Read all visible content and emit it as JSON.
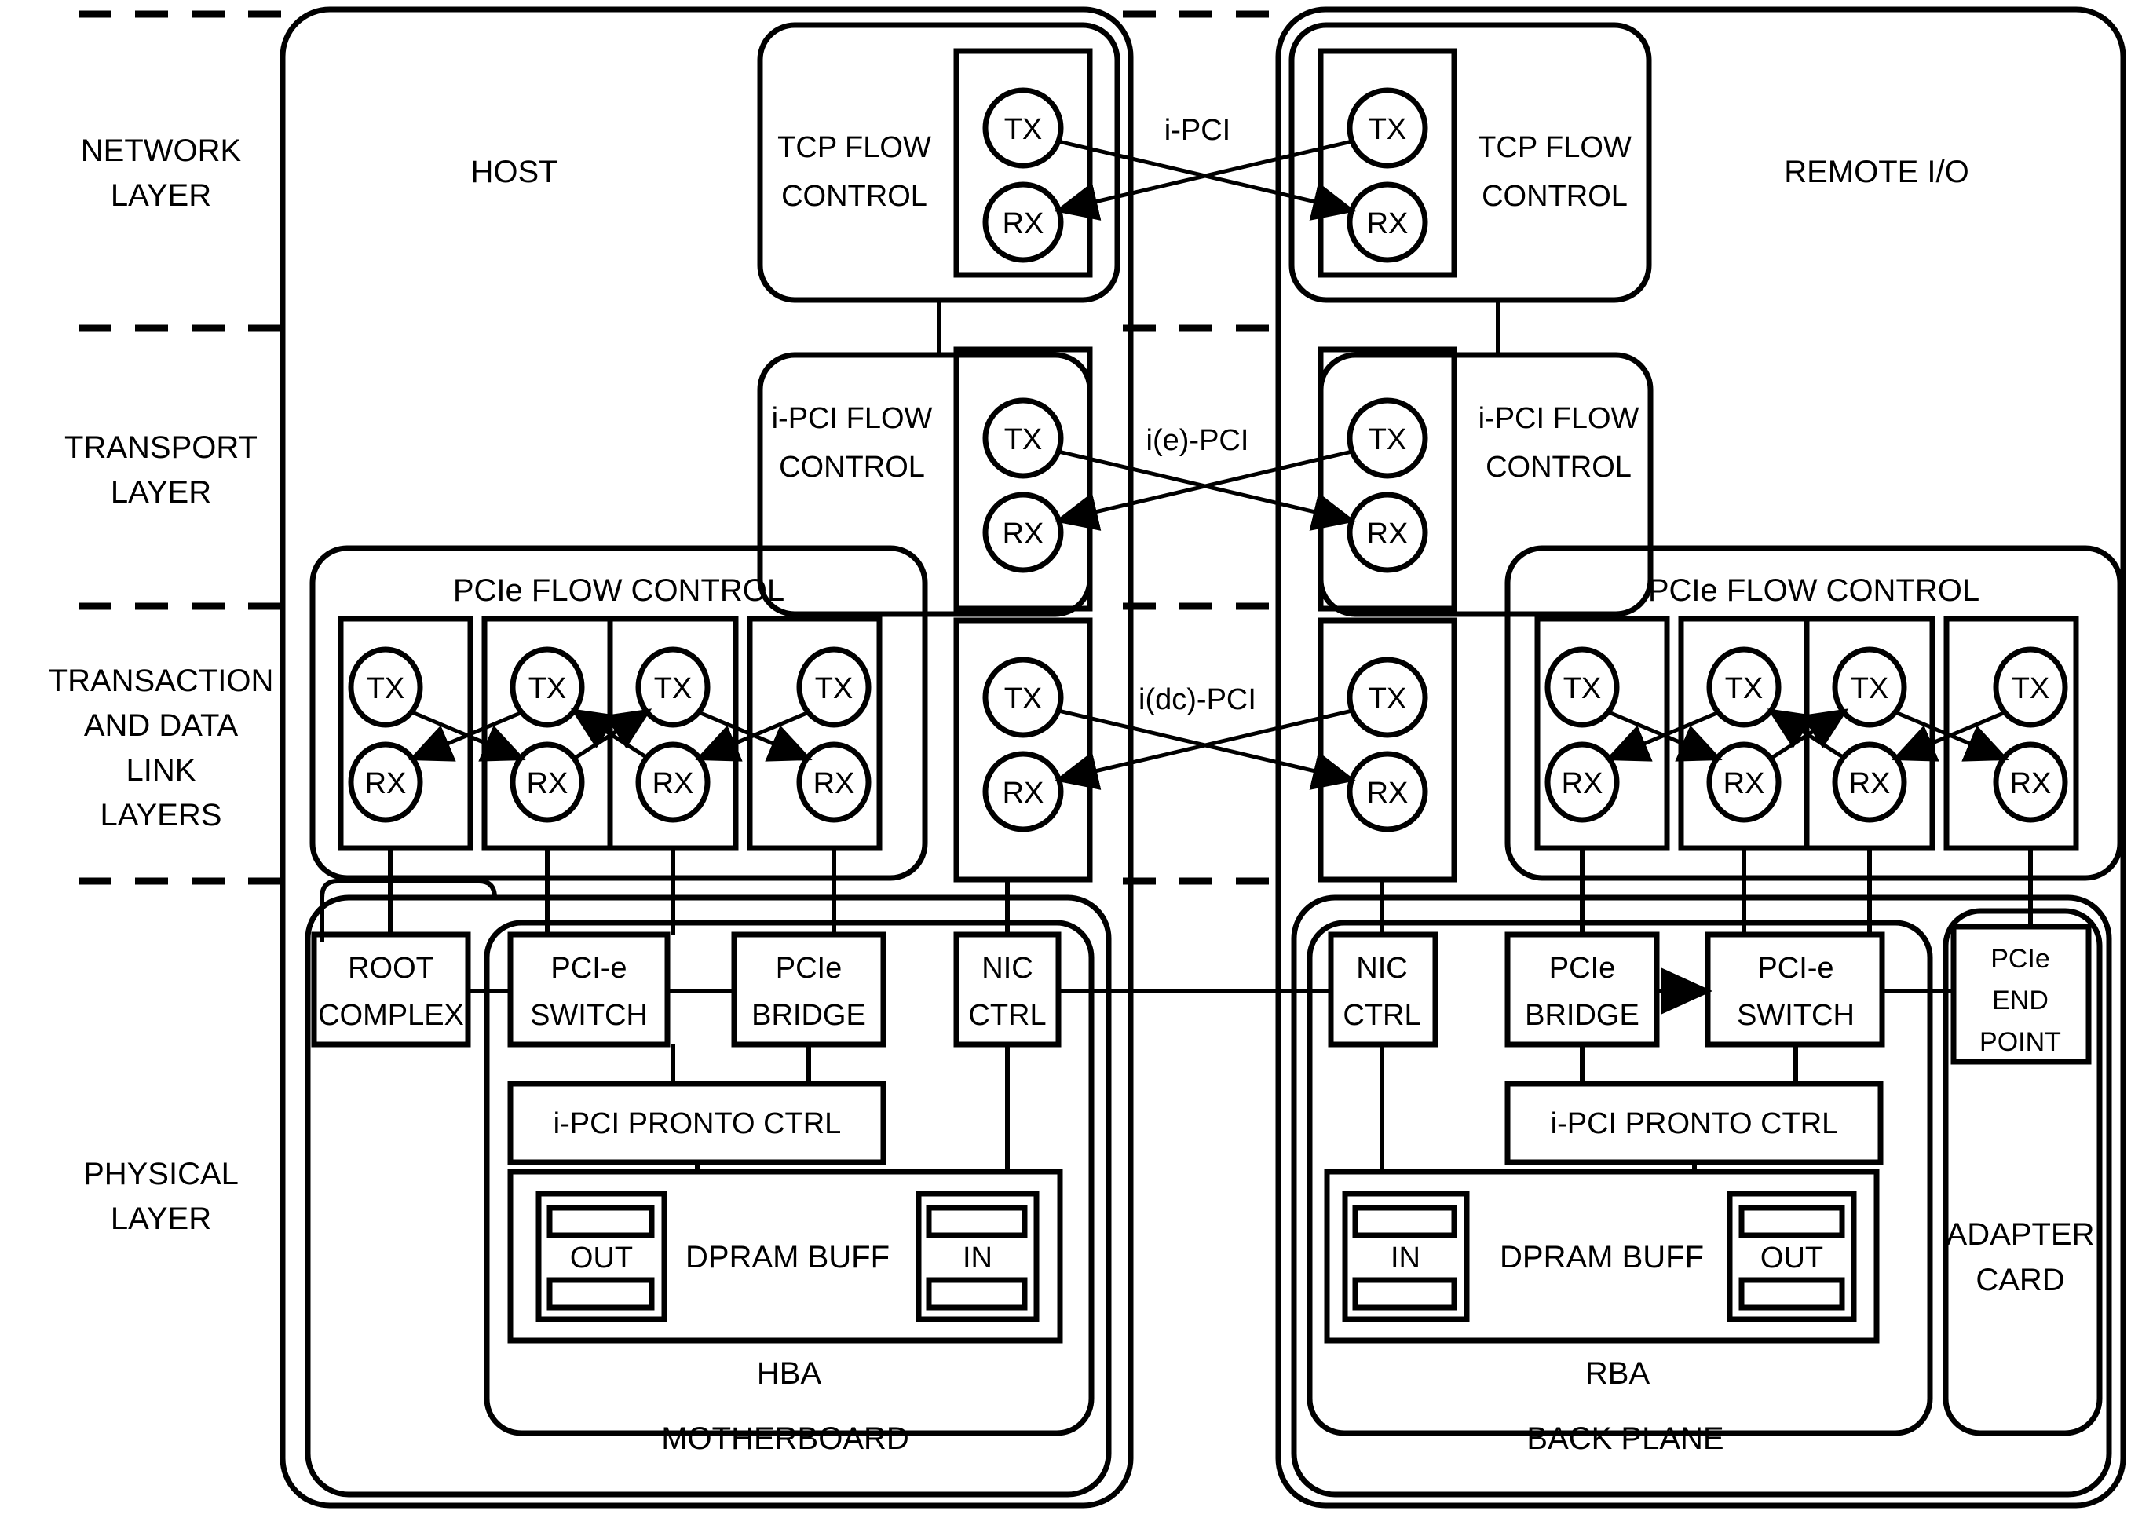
{
  "diagram": {
    "title_left_labels": [
      {
        "id": "network",
        "lines": [
          "NETWORK",
          "LAYER"
        ]
      },
      {
        "id": "transport",
        "lines": [
          "TRANSPORT",
          "LAYER"
        ]
      },
      {
        "id": "transaction",
        "lines": [
          "TRANSACTION",
          "AND DATA",
          "LINK",
          "LAYERS"
        ]
      },
      {
        "id": "physical",
        "lines": [
          "PHYSICAL",
          "LAYER"
        ]
      }
    ],
    "side_titles": {
      "host": "HOST",
      "remote": "REMOTE I/O"
    },
    "link_labels": {
      "network": "i-PCI",
      "transport": "i(e)-PCI",
      "transaction": "i(dc)-PCI"
    },
    "flow_controls": {
      "tcp": {
        "line1": "TCP FLOW",
        "line2": "CONTROL"
      },
      "ipci": {
        "line1": "i-PCI FLOW",
        "line2": "CONTROL"
      },
      "pcie": "PCIe FLOW CONTROL"
    },
    "port_labels": {
      "tx": "TX",
      "rx": "RX"
    },
    "host_blocks": {
      "root_complex": {
        "line1": "ROOT",
        "line2": "COMPLEX"
      },
      "pcie_switch": {
        "line1": "PCI-e",
        "line2": "SWITCH"
      },
      "pcie_bridge": {
        "line1": "PCIe",
        "line2": "BRIDGE"
      },
      "nic_ctrl": {
        "line1": "NIC",
        "line2": "CTRL"
      },
      "pronto": "i-PCI PRONTO CTRL",
      "dpram": "DPRAM BUFF",
      "buf_left": "OUT",
      "buf_right": "IN",
      "hba": "HBA",
      "motherboard": "MOTHERBOARD"
    },
    "remote_blocks": {
      "nic_ctrl": {
        "line1": "NIC",
        "line2": "CTRL"
      },
      "pcie_bridge": {
        "line1": "PCIe",
        "line2": "BRIDGE"
      },
      "pcie_switch": {
        "line1": "PCI-e",
        "line2": "SWITCH"
      },
      "pcie_endpoint": {
        "line1": "PCIe",
        "line2": "END",
        "line3": "POINT"
      },
      "pronto": "i-PCI PRONTO CTRL",
      "dpram": "DPRAM BUFF",
      "buf_left": "IN",
      "buf_right": "OUT",
      "rba": "RBA",
      "backplane": "BACK PLANE",
      "adapter": {
        "line1": "ADAPTER",
        "line2": "CARD"
      }
    },
    "colors": {
      "stroke": "#000000",
      "background": "#ffffff"
    }
  }
}
